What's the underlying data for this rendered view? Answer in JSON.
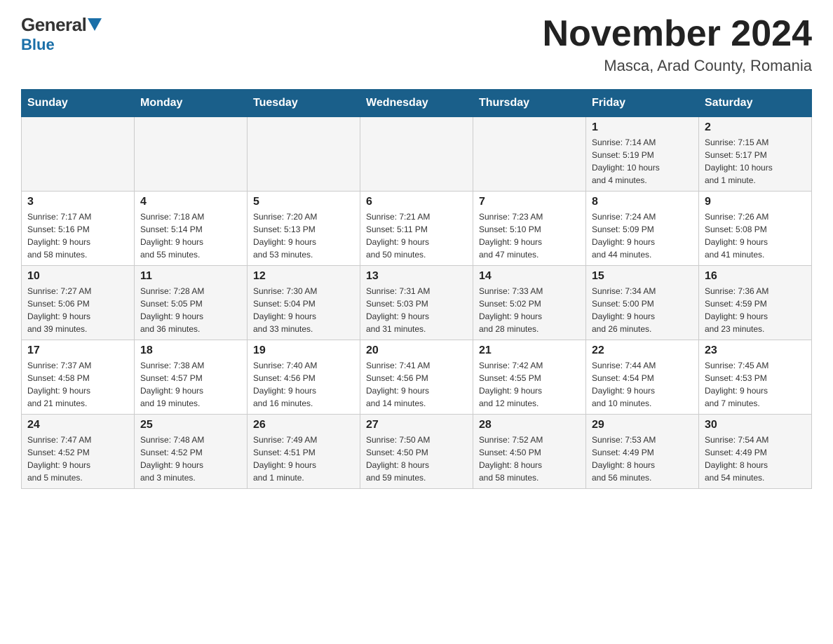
{
  "logo": {
    "general": "General",
    "blue": "Blue"
  },
  "title": "November 2024",
  "location": "Masca, Arad County, Romania",
  "days_of_week": [
    "Sunday",
    "Monday",
    "Tuesday",
    "Wednesday",
    "Thursday",
    "Friday",
    "Saturday"
  ],
  "weeks": [
    [
      {
        "day": "",
        "info": ""
      },
      {
        "day": "",
        "info": ""
      },
      {
        "day": "",
        "info": ""
      },
      {
        "day": "",
        "info": ""
      },
      {
        "day": "",
        "info": ""
      },
      {
        "day": "1",
        "info": "Sunrise: 7:14 AM\nSunset: 5:19 PM\nDaylight: 10 hours\nand 4 minutes."
      },
      {
        "day": "2",
        "info": "Sunrise: 7:15 AM\nSunset: 5:17 PM\nDaylight: 10 hours\nand 1 minute."
      }
    ],
    [
      {
        "day": "3",
        "info": "Sunrise: 7:17 AM\nSunset: 5:16 PM\nDaylight: 9 hours\nand 58 minutes."
      },
      {
        "day": "4",
        "info": "Sunrise: 7:18 AM\nSunset: 5:14 PM\nDaylight: 9 hours\nand 55 minutes."
      },
      {
        "day": "5",
        "info": "Sunrise: 7:20 AM\nSunset: 5:13 PM\nDaylight: 9 hours\nand 53 minutes."
      },
      {
        "day": "6",
        "info": "Sunrise: 7:21 AM\nSunset: 5:11 PM\nDaylight: 9 hours\nand 50 minutes."
      },
      {
        "day": "7",
        "info": "Sunrise: 7:23 AM\nSunset: 5:10 PM\nDaylight: 9 hours\nand 47 minutes."
      },
      {
        "day": "8",
        "info": "Sunrise: 7:24 AM\nSunset: 5:09 PM\nDaylight: 9 hours\nand 44 minutes."
      },
      {
        "day": "9",
        "info": "Sunrise: 7:26 AM\nSunset: 5:08 PM\nDaylight: 9 hours\nand 41 minutes."
      }
    ],
    [
      {
        "day": "10",
        "info": "Sunrise: 7:27 AM\nSunset: 5:06 PM\nDaylight: 9 hours\nand 39 minutes."
      },
      {
        "day": "11",
        "info": "Sunrise: 7:28 AM\nSunset: 5:05 PM\nDaylight: 9 hours\nand 36 minutes."
      },
      {
        "day": "12",
        "info": "Sunrise: 7:30 AM\nSunset: 5:04 PM\nDaylight: 9 hours\nand 33 minutes."
      },
      {
        "day": "13",
        "info": "Sunrise: 7:31 AM\nSunset: 5:03 PM\nDaylight: 9 hours\nand 31 minutes."
      },
      {
        "day": "14",
        "info": "Sunrise: 7:33 AM\nSunset: 5:02 PM\nDaylight: 9 hours\nand 28 minutes."
      },
      {
        "day": "15",
        "info": "Sunrise: 7:34 AM\nSunset: 5:00 PM\nDaylight: 9 hours\nand 26 minutes."
      },
      {
        "day": "16",
        "info": "Sunrise: 7:36 AM\nSunset: 4:59 PM\nDaylight: 9 hours\nand 23 minutes."
      }
    ],
    [
      {
        "day": "17",
        "info": "Sunrise: 7:37 AM\nSunset: 4:58 PM\nDaylight: 9 hours\nand 21 minutes."
      },
      {
        "day": "18",
        "info": "Sunrise: 7:38 AM\nSunset: 4:57 PM\nDaylight: 9 hours\nand 19 minutes."
      },
      {
        "day": "19",
        "info": "Sunrise: 7:40 AM\nSunset: 4:56 PM\nDaylight: 9 hours\nand 16 minutes."
      },
      {
        "day": "20",
        "info": "Sunrise: 7:41 AM\nSunset: 4:56 PM\nDaylight: 9 hours\nand 14 minutes."
      },
      {
        "day": "21",
        "info": "Sunrise: 7:42 AM\nSunset: 4:55 PM\nDaylight: 9 hours\nand 12 minutes."
      },
      {
        "day": "22",
        "info": "Sunrise: 7:44 AM\nSunset: 4:54 PM\nDaylight: 9 hours\nand 10 minutes."
      },
      {
        "day": "23",
        "info": "Sunrise: 7:45 AM\nSunset: 4:53 PM\nDaylight: 9 hours\nand 7 minutes."
      }
    ],
    [
      {
        "day": "24",
        "info": "Sunrise: 7:47 AM\nSunset: 4:52 PM\nDaylight: 9 hours\nand 5 minutes."
      },
      {
        "day": "25",
        "info": "Sunrise: 7:48 AM\nSunset: 4:52 PM\nDaylight: 9 hours\nand 3 minutes."
      },
      {
        "day": "26",
        "info": "Sunrise: 7:49 AM\nSunset: 4:51 PM\nDaylight: 9 hours\nand 1 minute."
      },
      {
        "day": "27",
        "info": "Sunrise: 7:50 AM\nSunset: 4:50 PM\nDaylight: 8 hours\nand 59 minutes."
      },
      {
        "day": "28",
        "info": "Sunrise: 7:52 AM\nSunset: 4:50 PM\nDaylight: 8 hours\nand 58 minutes."
      },
      {
        "day": "29",
        "info": "Sunrise: 7:53 AM\nSunset: 4:49 PM\nDaylight: 8 hours\nand 56 minutes."
      },
      {
        "day": "30",
        "info": "Sunrise: 7:54 AM\nSunset: 4:49 PM\nDaylight: 8 hours\nand 54 minutes."
      }
    ]
  ]
}
